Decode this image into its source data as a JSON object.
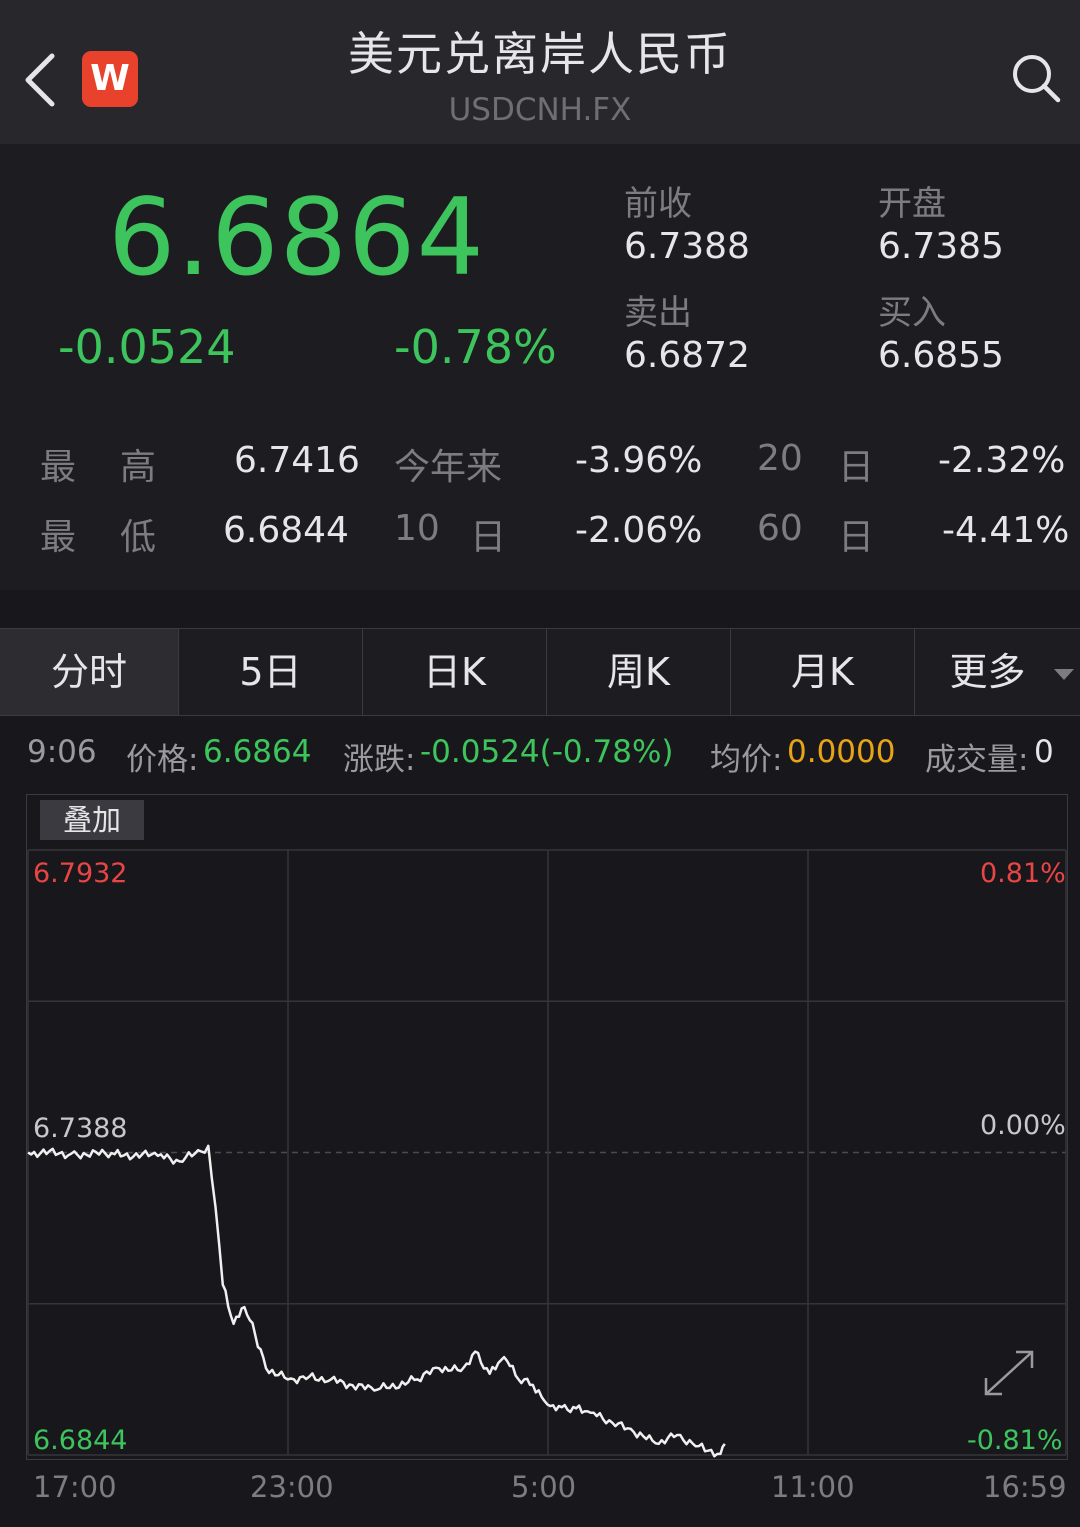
{
  "header": {
    "back_icon": "chevron-left-icon",
    "logo_text": "W",
    "title": "美元兑离岸人民币",
    "symbol": "USDCNH.FX",
    "search_icon": "search-icon"
  },
  "quote": {
    "price": "6.6864",
    "change": "-0.0524",
    "change_pct": "-0.78%",
    "prev_close_label": "前收",
    "prev_close": "6.7388",
    "open_label": "开盘",
    "open": "6.7385",
    "ask_label": "卖出",
    "ask": "6.6872",
    "bid_label": "买入",
    "bid": "6.6855"
  },
  "stats": {
    "high_label_1": "最",
    "high_label_2": "高",
    "high": "6.7416",
    "low_label_1": "最",
    "low_label_2": "低",
    "low": "6.6844",
    "ytd_label": "今年来",
    "ytd": "-3.96%",
    "d10_label_1": "10",
    "d10_label_2": "日",
    "d10": "-2.06%",
    "d20_label_1": "20",
    "d20_label_2": "日",
    "d20": "-2.32%",
    "d60_label_1": "60",
    "d60_label_2": "日",
    "d60": "-4.41%"
  },
  "tabs": [
    "分时",
    "5日",
    "日K",
    "周K",
    "月K",
    "更多"
  ],
  "infobar": {
    "time": "9:06",
    "price_label": "价格:",
    "price": "6.6864",
    "change_label": "涨跌:",
    "change": "-0.0524(-0.78%)",
    "avg_label": "均价:",
    "avg": "0.0000",
    "volume_label": "成交量:",
    "volume": "0"
  },
  "chart": {
    "overlay_button": "叠加",
    "y_top": "6.7932",
    "y_mid": "6.7388",
    "y_bottom": "6.6844",
    "pct_top": "0.81%",
    "pct_mid": "0.00%",
    "pct_bottom": "-0.81%",
    "time_labels": [
      "17:00",
      "23:00",
      "5:00",
      "11:00",
      "16:59"
    ],
    "expand_icon": "expand-icon",
    "colors": {
      "up": "#e84545",
      "down": "#3dc45c",
      "avg": "#e8a317"
    }
  },
  "chart_data": {
    "type": "line",
    "title": "",
    "xlabel": "",
    "ylabel": "",
    "ylim": [
      6.6844,
      6.7932
    ],
    "reference": 6.7388,
    "x_ticks": [
      "17:00",
      "23:00",
      "5:00",
      "11:00",
      "16:59"
    ],
    "series": [
      {
        "x": [
          "17:00",
          "18:00",
          "19:00",
          "20:00",
          "20:30",
          "21:00",
          "21:10",
          "21:20",
          "21:30",
          "21:45",
          "22:00",
          "22:15",
          "22:30",
          "23:00",
          "23:30",
          "0:00",
          "1:00",
          "2:00",
          "2:30",
          "3:00",
          "3:20",
          "3:40",
          "4:00",
          "4:20",
          "4:40",
          "5:00",
          "5:20",
          "5:40",
          "6:00",
          "6:30",
          "7:00",
          "7:30",
          "8:00",
          "8:30",
          "9:00",
          "9:06"
        ],
        "y": [
          6.7388,
          6.7386,
          6.7385,
          6.7382,
          6.7372,
          6.739,
          6.74,
          6.729,
          6.715,
          6.708,
          6.711,
          6.706,
          6.7,
          6.698,
          6.6985,
          6.698,
          6.696,
          6.698,
          6.7,
          6.6995,
          6.703,
          6.699,
          6.702,
          6.698,
          6.697,
          6.6935,
          6.693,
          6.6928,
          6.692,
          6.6902,
          6.6885,
          6.6865,
          6.688,
          6.686,
          6.6846,
          6.6864
        ]
      }
    ]
  }
}
